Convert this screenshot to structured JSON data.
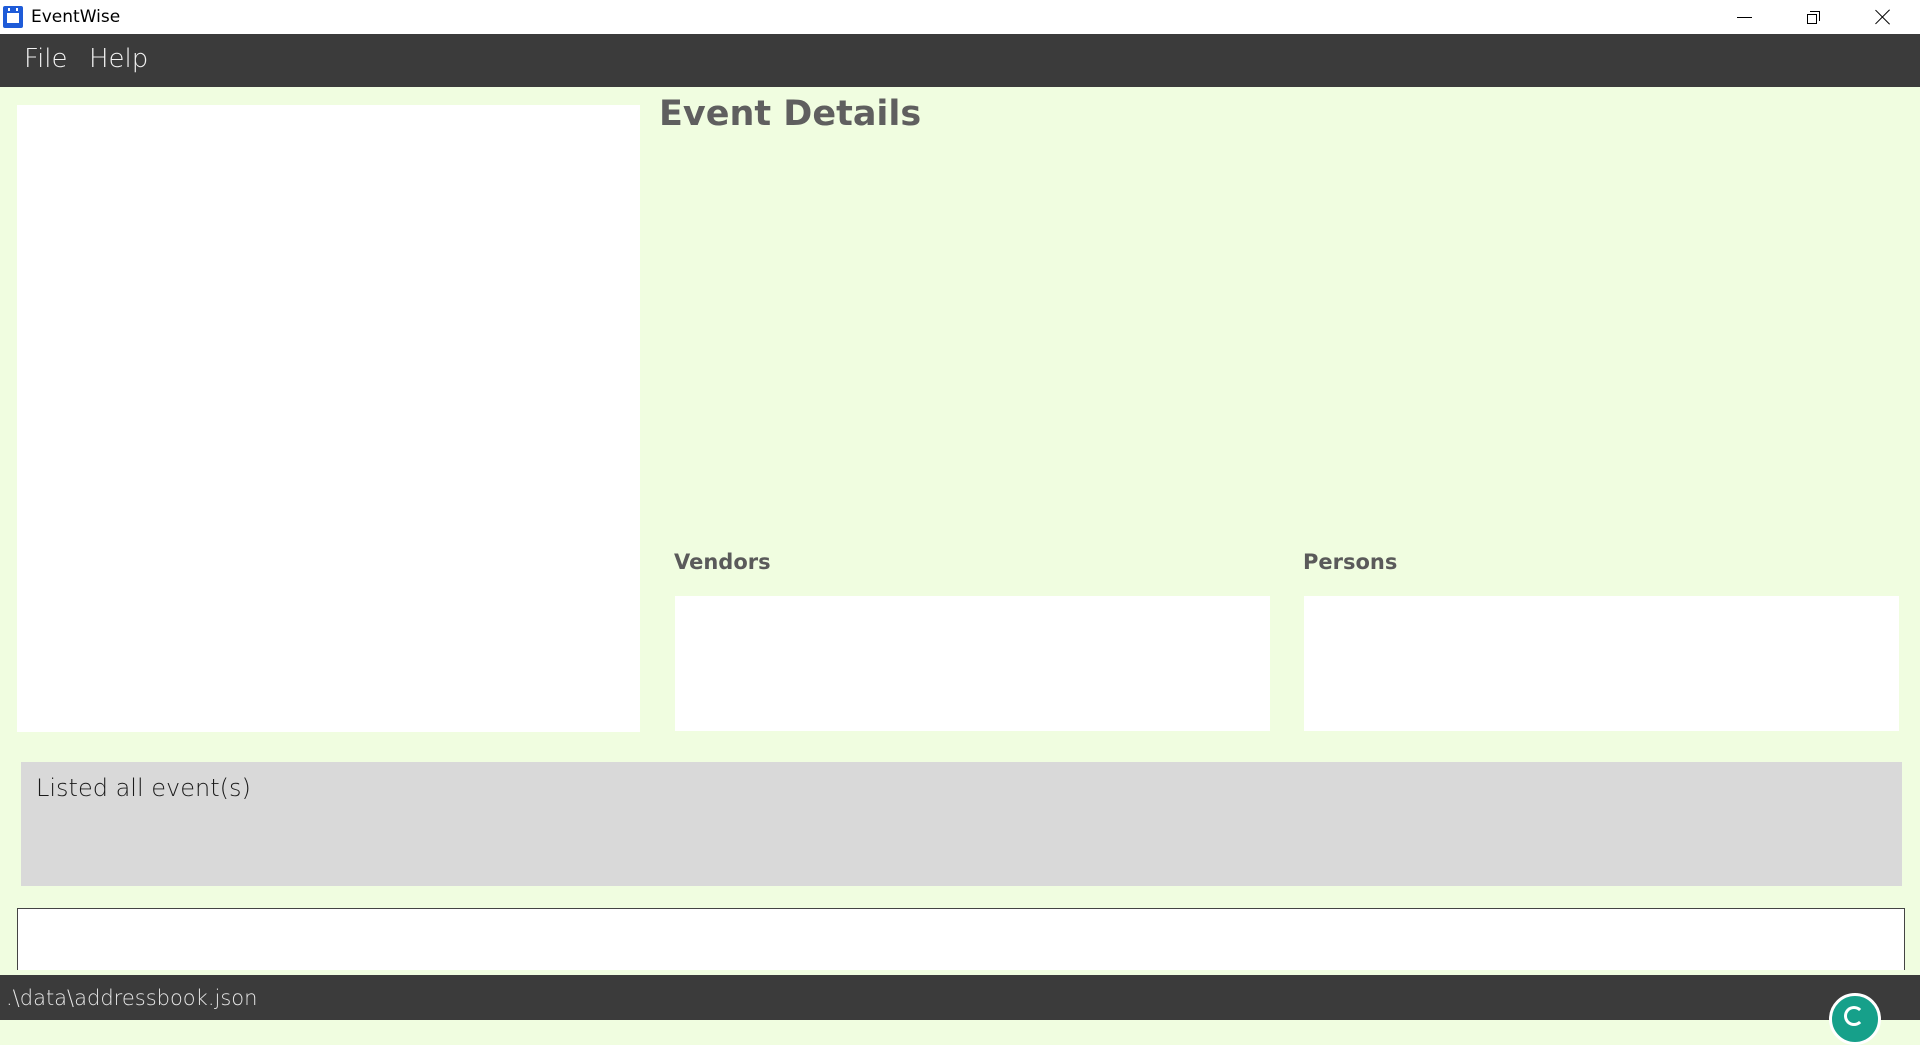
{
  "window": {
    "title": "EventWise",
    "icon": "calendar-icon",
    "controls": [
      "minimize-icon",
      "restore-icon",
      "close-icon"
    ]
  },
  "menu": {
    "file": "File",
    "help": "Help"
  },
  "details": {
    "title": "Event Details",
    "vendors_label": "Vendors",
    "persons_label": "Persons"
  },
  "result": {
    "message": "Listed all event(s)"
  },
  "command": {
    "value": ""
  },
  "status": {
    "path": ".\\data\\addressbook.json"
  },
  "colors": {
    "background": "#f0fde0",
    "bars": "#3b3b3b",
    "result_box": "#d9d9d9",
    "grammarly": "#16a08a"
  }
}
